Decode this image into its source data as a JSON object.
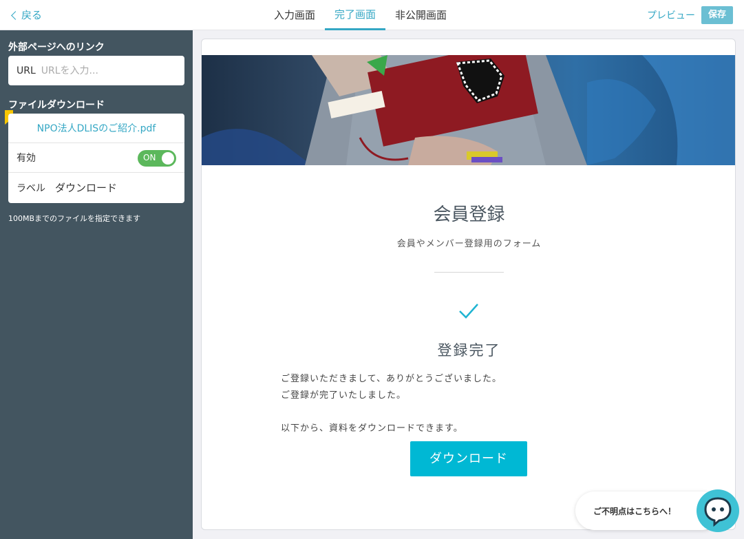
{
  "topbar": {
    "back_label": "戻る",
    "tabs": [
      {
        "label": "入力画面",
        "active": false
      },
      {
        "label": "完了画面",
        "active": true
      },
      {
        "label": "非公開画面",
        "active": false
      }
    ],
    "preview_label": "プレビュー",
    "save_label": "保存"
  },
  "sidebar": {
    "link_section_title": "外部ページへのリンク",
    "url_label": "URL",
    "url_placeholder": "URLを入力...",
    "url_value": "",
    "download_section_title": "ファイルダウンロード",
    "file_name": "NPO法人DLISのご紹介.pdf",
    "enabled_label": "有効",
    "toggle_text": "ON",
    "label_label": "ラベル",
    "label_value": "ダウンロード",
    "hint": "100MBまでのファイルを指定できます"
  },
  "preview": {
    "form_title": "会員登録",
    "form_subtitle": "会員やメンバー登録用のフォーム",
    "done_title": "登録完了",
    "message_line1": "ご登録いただきまして、ありがとうございました。",
    "message_line2": "ご登録が完了いたしました。",
    "message_line3": "以下から、資料をダウンロードできます。",
    "download_button": "ダウンロード"
  },
  "chat": {
    "text": "ご不明点はこちらへ！"
  },
  "colors": {
    "accent": "#34a7c4",
    "sidebar_bg": "#435560",
    "toggle_on": "#5cb85c",
    "download_button": "#00b8d4",
    "chat_icon": "#3fc2d5",
    "bookmark": "#f7c600"
  }
}
